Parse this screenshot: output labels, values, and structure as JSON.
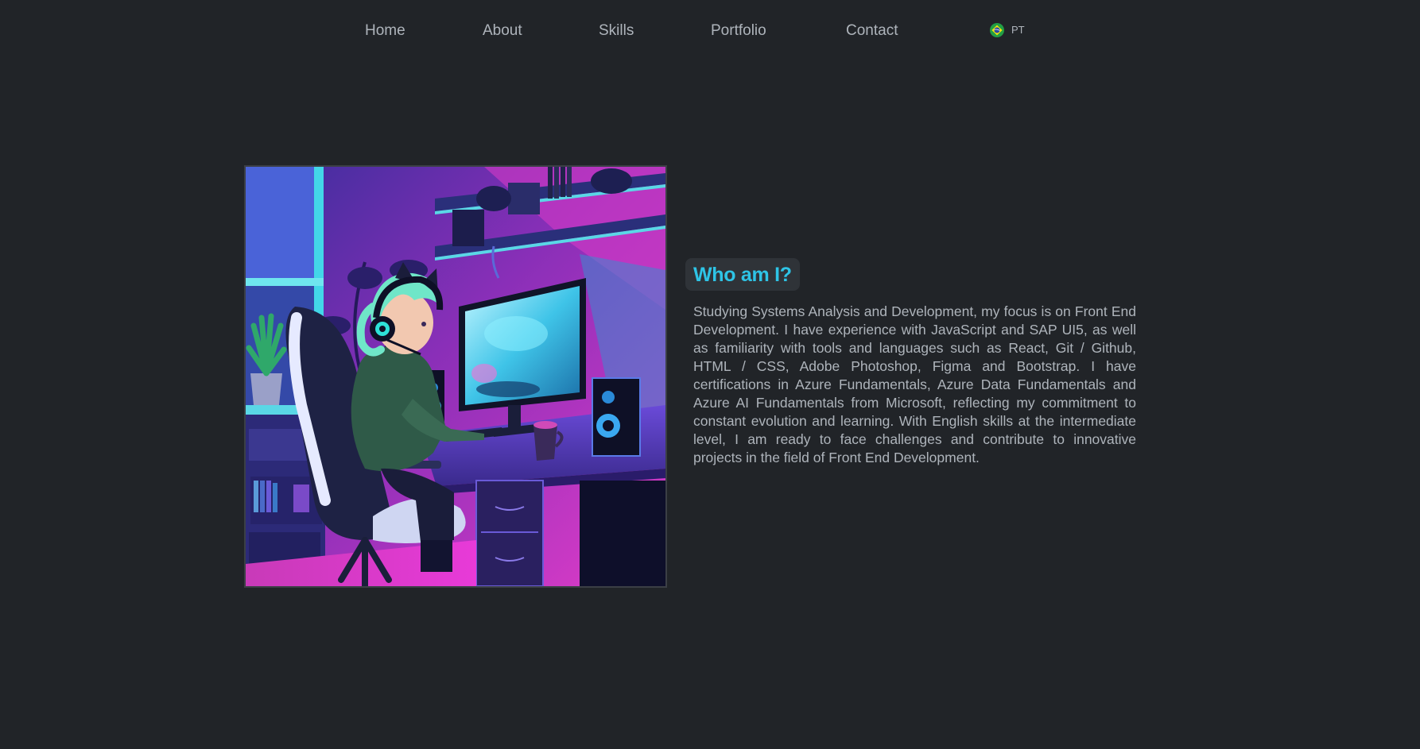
{
  "nav": {
    "items": [
      {
        "label": "Home"
      },
      {
        "label": "About"
      },
      {
        "label": "Skills"
      },
      {
        "label": "Portfolio"
      },
      {
        "label": "Contact"
      }
    ],
    "language": {
      "label": "PT",
      "flag_icon": "brazil-flag-icon"
    }
  },
  "about": {
    "image_icon": "illustration-girl-at-gaming-desk",
    "title": "Who am I?",
    "text": "Studying Systems Analysis and Development, my focus is on Front End Development. I have experience with JavaScript and SAP UI5, as well as familiarity with tools and languages such as React, Git / Github, HTML / CSS, Adobe Photoshop, Figma and Bootstrap. I have certifications in Azure Fundamentals, Azure Data Fundamentals and Azure AI Fundamentals from Microsoft, reflecting my commitment to constant evolution and learning. With English skills at the intermediate level, I am ready to face challenges and contribute to innovative projects in the field of Front End Development."
  },
  "colors": {
    "background": "#212428",
    "text": "#aeb4bb",
    "accent": "#2ec4e6",
    "title_bg": "#2f3338"
  }
}
